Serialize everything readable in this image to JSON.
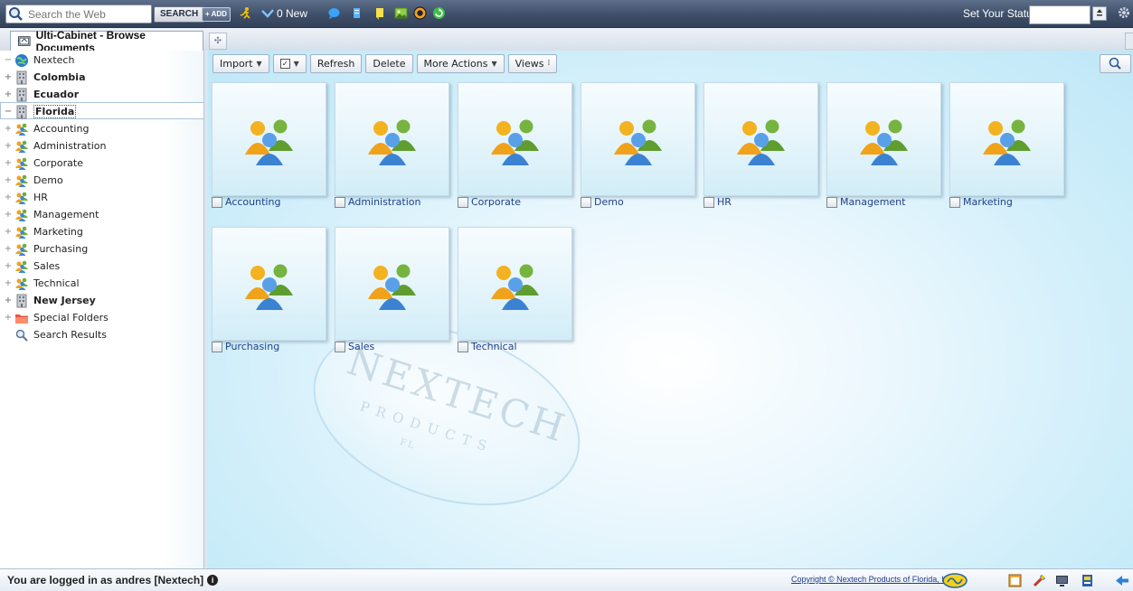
{
  "topbar": {
    "search_placeholder": "Search the Web",
    "search_button": "SEARCH",
    "add_button": "+ ADD",
    "mail_new": "0 New",
    "status_label": "Set Your Status:",
    "status_value": ""
  },
  "tab": {
    "title": "Ulti-Cabinet - Browse Documents"
  },
  "sidebar": {
    "items": [
      {
        "label": "Nextech",
        "bold": false,
        "icon": "globe-icon"
      },
      {
        "label": "Colombia",
        "bold": true,
        "icon": "building-icon"
      },
      {
        "label": "Ecuador",
        "bold": true,
        "icon": "building-icon"
      },
      {
        "label": "Florida",
        "bold": true,
        "icon": "building-icon",
        "selected": true
      },
      {
        "label": "Accounting",
        "bold": false,
        "icon": "group-icon"
      },
      {
        "label": "Administration",
        "bold": false,
        "icon": "group-icon"
      },
      {
        "label": "Corporate",
        "bold": false,
        "icon": "group-icon"
      },
      {
        "label": "Demo",
        "bold": false,
        "icon": "group-icon"
      },
      {
        "label": "HR",
        "bold": false,
        "icon": "group-icon"
      },
      {
        "label": "Management",
        "bold": false,
        "icon": "group-icon"
      },
      {
        "label": "Marketing",
        "bold": false,
        "icon": "group-icon"
      },
      {
        "label": "Purchasing",
        "bold": false,
        "icon": "group-icon"
      },
      {
        "label": "Sales",
        "bold": false,
        "icon": "group-icon"
      },
      {
        "label": "Technical",
        "bold": false,
        "icon": "group-icon"
      },
      {
        "label": "New Jersey",
        "bold": true,
        "icon": "building-icon"
      },
      {
        "label": "Special Folders",
        "bold": false,
        "icon": "folder-icon"
      },
      {
        "label": "Search Results",
        "bold": false,
        "icon": "search-icon"
      }
    ]
  },
  "actions": {
    "import": "Import",
    "refresh": "Refresh",
    "delete": "Delete",
    "more_actions": "More Actions",
    "views": "Views"
  },
  "folders": [
    {
      "label": "Accounting"
    },
    {
      "label": "Administration"
    },
    {
      "label": "Corporate"
    },
    {
      "label": "Demo"
    },
    {
      "label": "HR"
    },
    {
      "label": "Management"
    },
    {
      "label": "Marketing"
    },
    {
      "label": "Purchasing"
    },
    {
      "label": "Sales"
    },
    {
      "label": "Technical"
    }
  ],
  "footer": {
    "login_text": "You are logged in as andres [Nextech]",
    "copyright": "Copyright © Nextech Products of Florida, LLC"
  },
  "watermark": {
    "line1": "NEXTECH",
    "line2": "PRODUCTS",
    "line3": "FL"
  }
}
